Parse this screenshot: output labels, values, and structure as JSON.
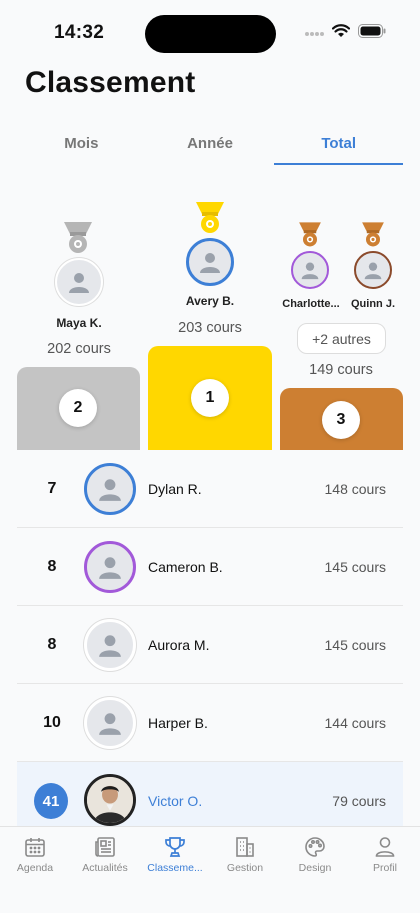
{
  "status": {
    "time": "14:32"
  },
  "page_title": "Classement",
  "tabs": [
    {
      "label": "Mois",
      "active": false
    },
    {
      "label": "Année",
      "active": false
    },
    {
      "label": "Total",
      "active": true
    }
  ],
  "podium": {
    "second": {
      "name": "Maya K.",
      "count": "202 cours",
      "rank": "2"
    },
    "first": {
      "name": "Avery B.",
      "count": "203 cours",
      "rank": "1"
    },
    "third": {
      "names": [
        "Charlotte...",
        "Quinn J."
      ],
      "more": "+2 autres",
      "count": "149 cours",
      "rank": "3"
    }
  },
  "colors": {
    "accent": "#3d7fd6",
    "gold": "#ffd700",
    "silver": "#c4c4c4",
    "bronze": "#cd7f32",
    "ring_blue": "#3d7fd6",
    "ring_purple": "#a259d9",
    "ring_brown": "#8b4a2b"
  },
  "list": [
    {
      "rank": "7",
      "name": "Dylan R.",
      "count": "148 cours",
      "ring": "blue"
    },
    {
      "rank": "8",
      "name": "Cameron B.",
      "count": "145 cours",
      "ring": "purple"
    },
    {
      "rank": "8",
      "name": "Aurora M.",
      "count": "145 cours",
      "ring": "none"
    },
    {
      "rank": "10",
      "name": "Harper B.",
      "count": "144 cours",
      "ring": "none"
    }
  ],
  "me": {
    "rank": "41",
    "name": "Victor O.",
    "count": "79 cours"
  },
  "tabbar": [
    {
      "label": "Agenda",
      "icon": "calendar-icon",
      "active": false
    },
    {
      "label": "Actualités",
      "icon": "newspaper-icon",
      "active": false
    },
    {
      "label": "Classeme...",
      "icon": "trophy-icon",
      "active": true
    },
    {
      "label": "Gestion",
      "icon": "building-icon",
      "active": false
    },
    {
      "label": "Design",
      "icon": "palette-icon",
      "active": false
    },
    {
      "label": "Profil",
      "icon": "person-icon",
      "active": false
    }
  ]
}
